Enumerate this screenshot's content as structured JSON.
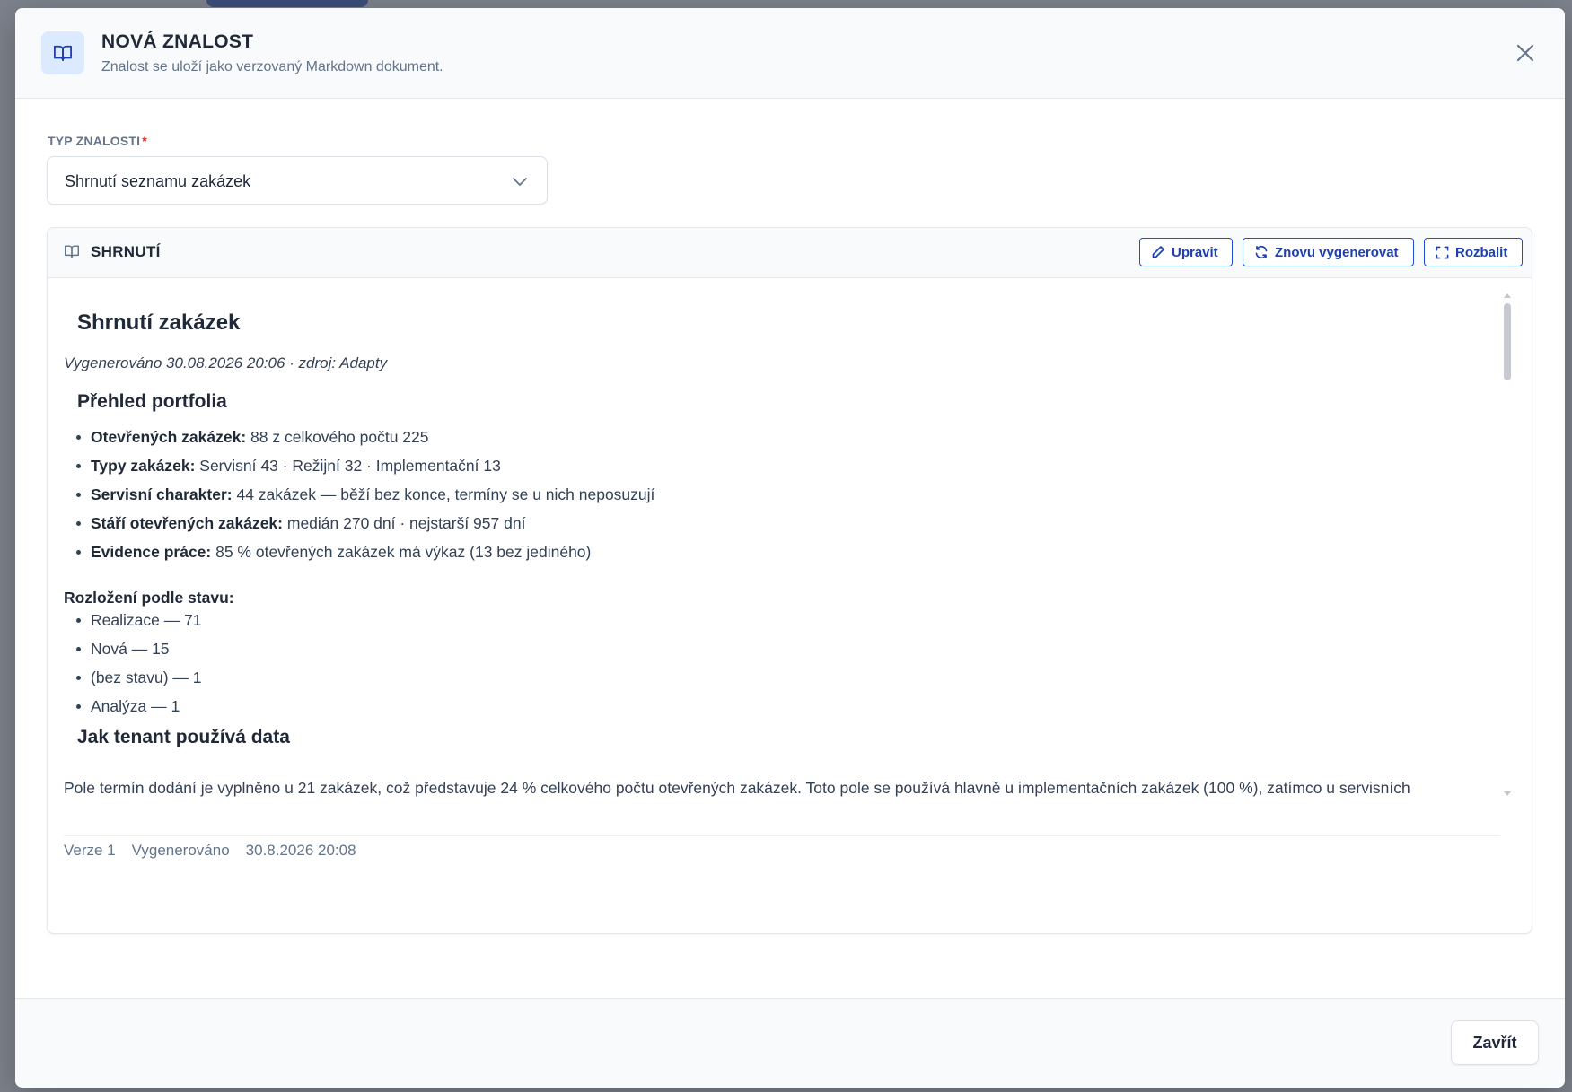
{
  "dialog": {
    "title": "NOVÁ ZNALOST",
    "subtitle": "Znalost se uloží jako verzovaný Markdown dokument.",
    "header_icon": "book-open-icon",
    "close_icon": "close-icon",
    "accent_color": "#1d4ed8"
  },
  "type_field": {
    "label": "TYP ZNALOSTI",
    "required_mark": "*",
    "selected_value": "Shrnutí seznamu zakázek"
  },
  "panel": {
    "title": "SHRNUTÍ",
    "buttons": {
      "edit": "Upravit",
      "regenerate": "Znovu vygenerovat",
      "expand": "Rozbalit"
    }
  },
  "document": {
    "heading": "Shrnutí zakázek",
    "meta": "Vygenerováno 30.08.2026 20:06 · zdroj: Adapty",
    "section1": {
      "heading": "Přehled portfolia",
      "items": [
        {
          "label": "Otevřených zakázek:",
          "text": " 88 z celkového počtu 225"
        },
        {
          "label": "Typy zakázek:",
          "text": " Servisní 43 · Režijní 32 · Implementační 13"
        },
        {
          "label": "Servisní charakter:",
          "text": " 44 zakázek — běží bez konce, termíny se u nich neposuzují"
        },
        {
          "label": "Stáří otevřených zakázek:",
          "text": " medián 270 dní · nejstarší 957 dní"
        },
        {
          "label": "Evidence práce:",
          "text": " 85 % otevřených zakázek má výkaz (13 bez jediného)"
        }
      ]
    },
    "status_heading": "Rozložení podle stavu:",
    "status_items": [
      "Realizace — 71",
      "Nová — 15",
      "(bez stavu) — 1",
      "Analýza — 1"
    ],
    "section2": {
      "heading": "Jak tenant používá data",
      "paragraph": "Pole termín dodání je vyplněno u 21 zakázek, což představuje 24 % celkového počtu otevřených zakázek. Toto pole se používá hlavně u implementačních zakázek (100 %), zatímco u servisních"
    }
  },
  "version": {
    "label": "Verze 1",
    "status": "Vygenerováno",
    "date": "30.8.2026 20:08"
  },
  "footer": {
    "close_label": "Zavřít"
  }
}
